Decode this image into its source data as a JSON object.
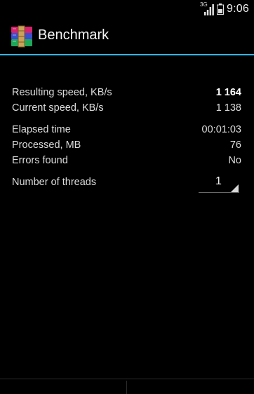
{
  "status_bar": {
    "network_type": "3G",
    "time": "9:06"
  },
  "action_bar": {
    "title": "Benchmark",
    "icon": "winrar-books-icon"
  },
  "stats": [
    {
      "label": "Resulting speed, KB/s",
      "value": "1 164",
      "bold": true
    },
    {
      "label": "Current speed, KB/s",
      "value": "1 138"
    },
    {
      "label": "Elapsed time",
      "value": "00:01:03"
    },
    {
      "label": "Processed, MB",
      "value": "76"
    },
    {
      "label": "Errors found",
      "value": "No"
    }
  ],
  "threads": {
    "label": "Number of threads",
    "value": "1"
  },
  "colors": {
    "accent": "#33b5e5",
    "background": "#000000"
  }
}
